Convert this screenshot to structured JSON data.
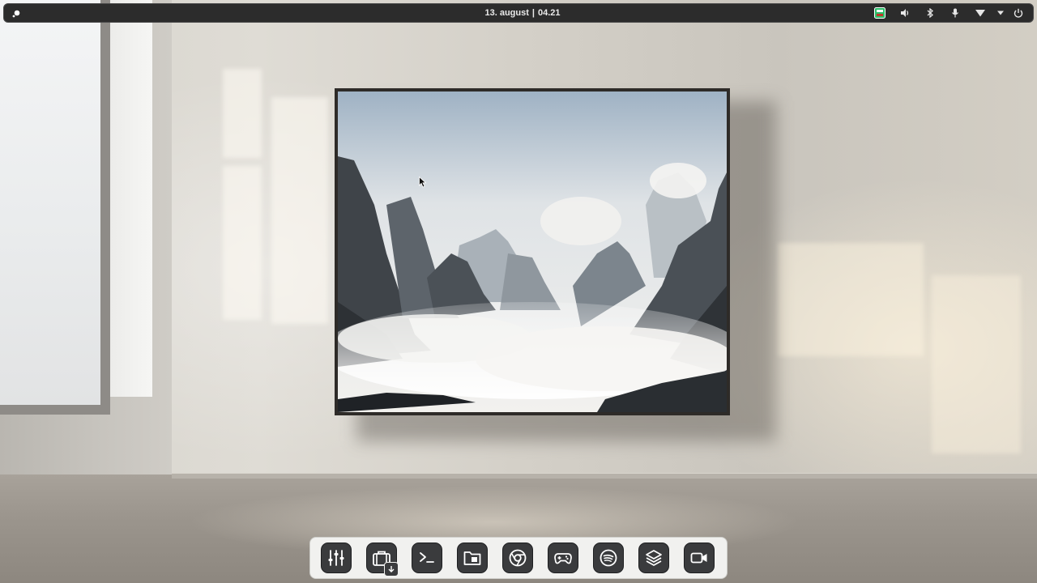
{
  "topbar": {
    "date": "13. august",
    "separator": "|",
    "time": "04.21",
    "menu_icon": "menu-icon",
    "tray": [
      {
        "name": "tray-app-icon",
        "icon": "green-app-icon"
      },
      {
        "name": "volume-icon",
        "icon": "speaker-icon"
      },
      {
        "name": "bluetooth-icon",
        "icon": "bluetooth-icon"
      },
      {
        "name": "microphone-icon",
        "icon": "microphone-icon"
      },
      {
        "name": "wifi-icon",
        "icon": "wifi-icon"
      },
      {
        "name": "system-menu-chevron-icon",
        "icon": "chevron-down-icon"
      },
      {
        "name": "power-icon",
        "icon": "power-icon"
      }
    ]
  },
  "dock": {
    "items": [
      {
        "name": "mixer-settings",
        "icon": "sliders-icon"
      },
      {
        "name": "software-store",
        "icon": "briefcase-download-icon"
      },
      {
        "name": "terminal",
        "icon": "terminal-icon"
      },
      {
        "name": "files",
        "icon": "folder-icon"
      },
      {
        "name": "chrome-browser",
        "icon": "chrome-icon"
      },
      {
        "name": "games",
        "icon": "gamepad-icon"
      },
      {
        "name": "spotify",
        "icon": "spotify-icon"
      },
      {
        "name": "layers-app",
        "icon": "layers-icon"
      },
      {
        "name": "video-recorder",
        "icon": "video-camera-icon"
      }
    ]
  },
  "colors": {
    "topbar_bg": "#2c2c2c",
    "dock_bg": "#f1f1ef",
    "dock_icon_bg": "#3a3b3d",
    "tray_accent": "#2bbf6a"
  }
}
